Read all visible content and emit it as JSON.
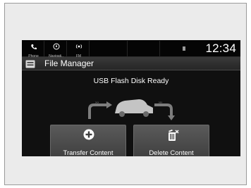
{
  "statusbar": {
    "phone_label": "Phone",
    "navi_label": "Navigati..",
    "fm_label": "FM",
    "clock": "12:34"
  },
  "titlebar": {
    "title": "File Manager",
    "icon": "file-manager-icon"
  },
  "main": {
    "status_message": "USB Flash Disk Ready",
    "illustration": "car-transfer-icon"
  },
  "actions": [
    {
      "label": "Transfer Content",
      "icon": "plus-circle-icon"
    },
    {
      "label": "Delete Content",
      "icon": "trash-icon"
    }
  ]
}
